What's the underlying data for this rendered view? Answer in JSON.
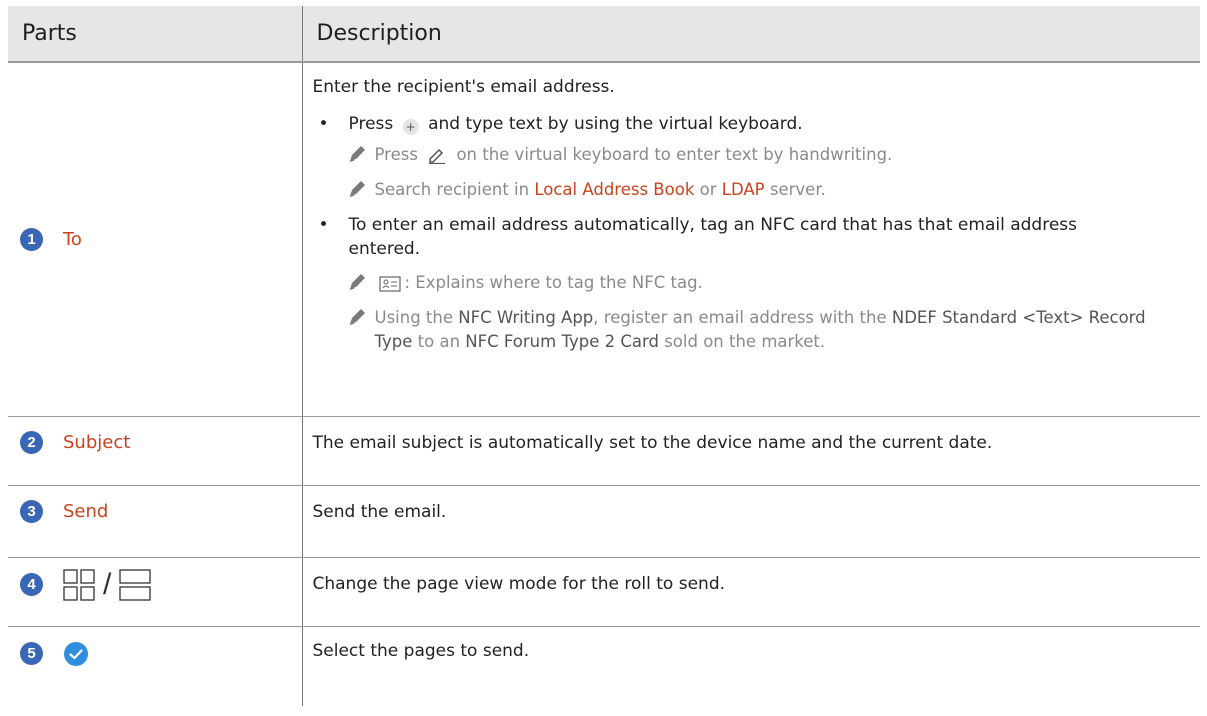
{
  "header": {
    "col1": "Parts",
    "col2": "Description"
  },
  "rows": [
    {
      "number": "1",
      "part": "To",
      "intro": "Enter the recipient's email address.",
      "bullet1": {
        "before": "Press",
        "after": "and type text by using the virtual keyboard."
      },
      "note1": {
        "before": "Press",
        "after": "on the virtual keyboard to enter text by handwriting."
      },
      "note2": {
        "before": "Search recipient in",
        "link1": "Local Address Book",
        "mid": "or",
        "link2": "LDAP",
        "after": "server."
      },
      "bullet2": "To enter an email address automatically, tag an NFC card that has that email address entered.",
      "note3": ": Explains where to tag the NFC tag.",
      "note4": {
        "t1": "Using the",
        "b1": "NFC Writing App",
        "t2": ", register an email address with the",
        "b2": "NDEF Standard <Text> Record Type",
        "t3": "to an",
        "b3": "NFC Forum Type 2 Card",
        "t4": "sold on the market."
      }
    },
    {
      "number": "2",
      "part": "Subject",
      "desc": "The email subject is automatically set to the device name and the current date."
    },
    {
      "number": "3",
      "part": "Send",
      "desc": "Send the email."
    },
    {
      "number": "4",
      "part_icons": [
        "grid-view-icon",
        "slash",
        "list-view-icon"
      ],
      "slash": "/",
      "desc": "Change the page view mode for the roll to send."
    },
    {
      "number": "5",
      "part_icons": [
        "check-circle-icon"
      ],
      "desc": "Select the pages to send."
    }
  ],
  "colors": {
    "accent": "#c8431d",
    "number_badge": "#3a66b6",
    "check": "#2f8fde",
    "header_bg": "#e6e6e6"
  }
}
